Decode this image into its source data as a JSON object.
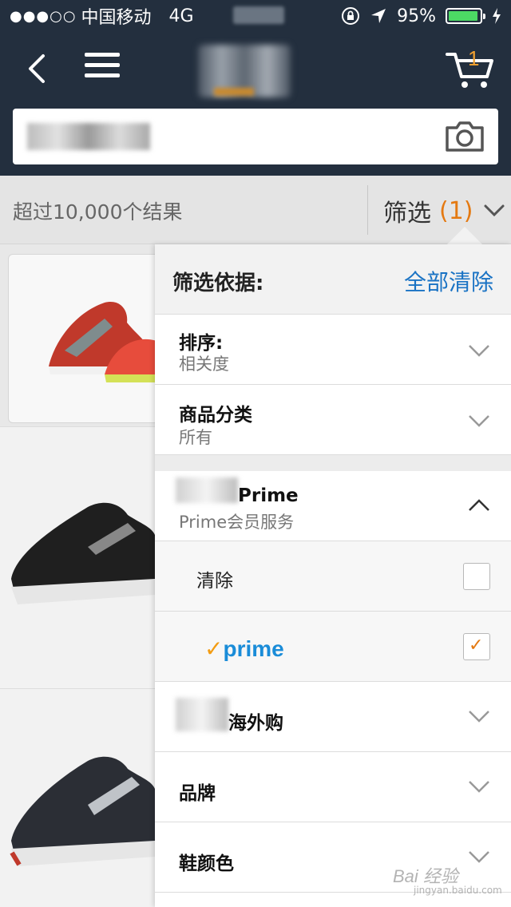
{
  "status_bar": {
    "signal": "●●●○○",
    "carrier": "中国移动",
    "network": "4G",
    "battery": "95%",
    "battery_level": 0.95,
    "location_icon": "location-arrow-icon",
    "lock_icon": "rotation-lock-icon",
    "charging_icon": "charging-bolt-icon"
  },
  "nav": {
    "back_icon": "chevron-left-icon",
    "menu_icon": "hamburger-menu-icon",
    "cart_icon": "shopping-cart-icon",
    "cart_count": "1",
    "camera_icon": "camera-icon"
  },
  "results": {
    "count_text": "超过10,000个结果",
    "filter_label": "筛选",
    "filter_count": "(1)"
  },
  "filter_panel": {
    "title": "筛选依据:",
    "clear_all": "全部清除",
    "sections": [
      {
        "title": "排序:",
        "subtitle": "相关度"
      },
      {
        "title": "商品分类",
        "subtitle": "所有"
      },
      {
        "title": "Prime",
        "subtitle": "Prime会员服务",
        "expanded": true
      },
      {
        "title": "海外购"
      },
      {
        "title": "品牌"
      },
      {
        "title": "鞋颜色"
      }
    ],
    "prime_options": [
      {
        "label": "清除",
        "checked": false
      },
      {
        "logo_text": "prime",
        "checked": true
      }
    ]
  },
  "watermark": {
    "text": "Bai 经验",
    "sub": "jingyan.baidu.com"
  },
  "colors": {
    "navbar": "#232f3e",
    "accent_orange": "#e47911",
    "link_blue": "#1a73c4",
    "prime_blue": "#1a8cd8"
  }
}
